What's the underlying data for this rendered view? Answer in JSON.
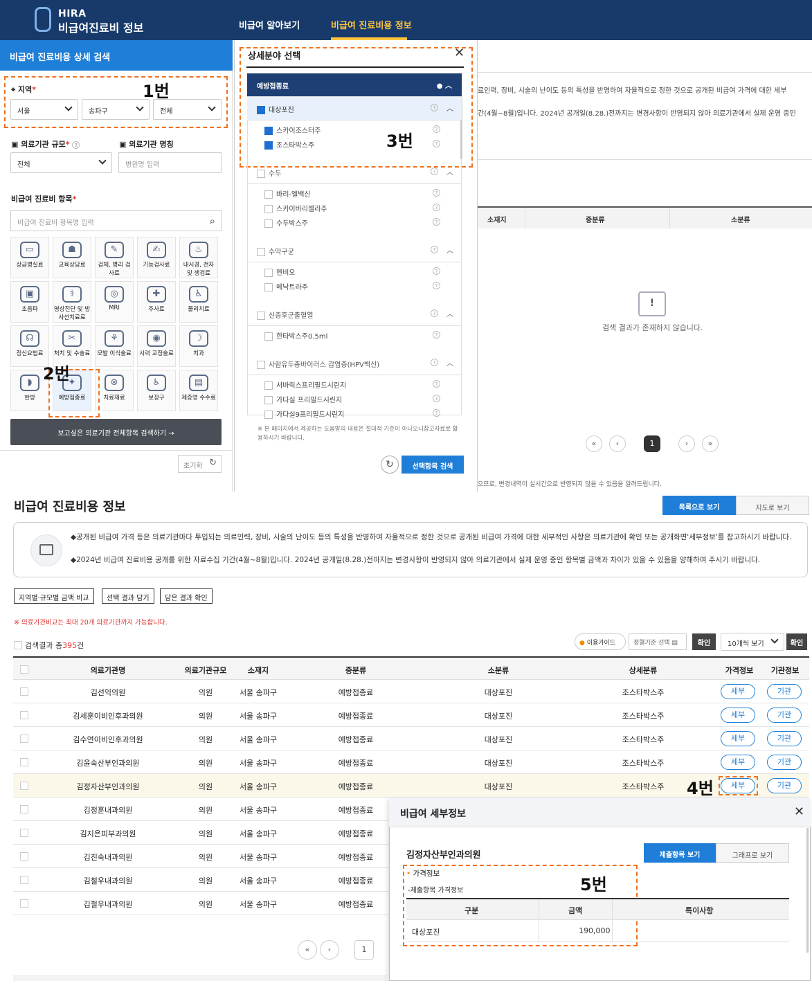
{
  "header": {
    "logo_top": "HIRA",
    "logo_bottom": "비급여진료비 정보",
    "nav": [
      "비급여 알아보기",
      "비급여 진료비용 정보"
    ]
  },
  "left_panel": {
    "title": "비급여 진료비용 상세 검색",
    "region_label": "지역",
    "region_selects": [
      "서울",
      "송파구",
      "전체"
    ],
    "scale_label": "의료기관 규모",
    "scale_value": "전체",
    "name_label": "의료기관 명칭",
    "name_placeholder": "병원명 입력",
    "items_label": "비급여 진료비 항목",
    "items_placeholder": "비급여 진료비 항목명 입력",
    "categories": [
      "상급병실료",
      "교육상담료",
      "검체, 병리 검사료",
      "기능검사료",
      "내시경, 천자 및 생검료",
      "초음파",
      "영상진단 및 방사선치료료",
      "MRI",
      "주사료",
      "물리치료",
      "정신요법료",
      "처치 및 수술료",
      "모발 이식술료",
      "시력 교정술료",
      "치과",
      "한방",
      "예방접종료",
      "치료재료",
      "보장구",
      "제증명 수수료"
    ],
    "search_all_button": "보고싶은 의료기관 전체항목 검색하기 →",
    "reset_button": "초기화"
  },
  "labels": {
    "n1": "1번",
    "n2": "2번",
    "n3": "3번",
    "n4": "4번",
    "n5": "5번"
  },
  "modal": {
    "title": "상세분야 선택",
    "group1": "예방접종료",
    "groups": [
      {
        "name": "대상포진",
        "items": [
          "스카이조스터주",
          "조스타박스주"
        ]
      },
      {
        "name": "수두",
        "items": [
          "바리-엘백신",
          "스카이바리셀라주",
          "수두박스주"
        ]
      },
      {
        "name": "수막구균",
        "items": [
          "멘비오",
          "메낙트라주"
        ]
      },
      {
        "name": "신증후군출혈열",
        "items": [
          "한타박스주0.5ml"
        ]
      },
      {
        "name": "사람유두종바이러스 감염증(HPV백신)",
        "items": [
          "서바릭스프리필드시린지",
          "가다실 프리필드시린지",
          "가다실9프리필드시린지"
        ]
      }
    ],
    "note": "※ 본 페이지에서 제공하는 도움말의 내용은 절대적 기준이 아니오니참고자료로 활용하시기 바랍니다.",
    "search_button": "선택항목 검색"
  },
  "right_panel": {
    "text1": "료인력, 장비, 시술의 난이도 등의 특성을 반영하여 자율적으로 정한 것으로 공개된 비급여 가격에 대한 세부",
    "text2": "간(4월~8월)입니다. 2024년 공개일(8.28.)전까지는 변경사항이 반영되지 않아 의료기관에서 실제 운영 중인",
    "cols": [
      "소재지",
      "중분류",
      "소분류"
    ],
    "empty": "검색 결과가 존재하지 않습니다.",
    "page": "1",
    "footnote": "으므로, 변경내역이 실시간으로 반영되지 않을 수 있음을 알려드립니다."
  },
  "main": {
    "title": "비급여 진료비용 정보",
    "view_list": "목록으로 보기",
    "view_map": "지도로 보기",
    "info1": "◆공개된 비급여 가격 등은 의료기관마다 투입되는 의료인력, 장비, 시술의 난이도 등의 특성을 반영하여 자율적으로 정한 것으로 공개된 비급여 가격에 대한 세부적인 사항은 의료기관에 확인 또는 공개화면'세부정보'를 참고하시기 바랍니다.",
    "info2": "◆2024년 비급여 진료비용 공개를 위한 자료수집 기간(4월~8월)입니다. 2024년 공개일(8.28.)전까지는 변경사항이 반영되지 않아 의료기관에서 실제 운영 중인 항목별 금액과 차이가 있을 수 있음을 양해하여 주시기 바랍니다.",
    "buttons": [
      "지역별·규모별 금액 비교",
      "선택 결과 담기",
      "담은 결과 확인"
    ],
    "warning": "※ 의료기관비교는 최대 20개 의료기관까지 가능합니다.",
    "result_prefix": "검색결과 총",
    "result_count": "395",
    "result_suffix": "건",
    "guide": "이용가이드",
    "sort": "정렬기준 선택",
    "confirm": "확인",
    "per_page": "10개씩 보기",
    "columns": [
      "의료기관명",
      "의료기관규모",
      "소재지",
      "중분류",
      "소분류",
      "상세분류",
      "가격정보",
      "기관정보"
    ],
    "rows": [
      {
        "name": "김선익의원",
        "scale": "의원",
        "loc": "서울 송파구",
        "mid": "예방접종료",
        "small": "대상포진",
        "detail": "조스타박스주"
      },
      {
        "name": "김세훈이비인후과의원",
        "scale": "의원",
        "loc": "서울 송파구",
        "mid": "예방접종료",
        "small": "대상포진",
        "detail": "조스타박스주"
      },
      {
        "name": "김수연이비인후과의원",
        "scale": "의원",
        "loc": "서울 송파구",
        "mid": "예방접종료",
        "small": "대상포진",
        "detail": "조스타박스주"
      },
      {
        "name": "김윤숙산부인과의원",
        "scale": "의원",
        "loc": "서울 송파구",
        "mid": "예방접종료",
        "small": "대상포진",
        "detail": "조스타박스주"
      },
      {
        "name": "김정자산부인과의원",
        "scale": "의원",
        "loc": "서울 송파구",
        "mid": "예방접종료",
        "small": "대상포진",
        "detail": "조스타박스주"
      },
      {
        "name": "김정훈내과의원",
        "scale": "의원",
        "loc": "서울 송파구",
        "mid": "예방접종료"
      },
      {
        "name": "김지은피부과의원",
        "scale": "의원",
        "loc": "서울 송파구",
        "mid": "예방접종료"
      },
      {
        "name": "김진숙내과의원",
        "scale": "의원",
        "loc": "서울 송파구",
        "mid": "예방접종료"
      },
      {
        "name": "김철우내과의원",
        "scale": "의원",
        "loc": "서울 송파구",
        "mid": "예방접종료"
      },
      {
        "name": "김철우내과의원",
        "scale": "의원",
        "loc": "서울 송파구",
        "mid": "예방접종료"
      }
    ],
    "detail_btn": "세부",
    "inst_btn": "기관"
  },
  "detail_panel": {
    "title": "비급여 세부정보",
    "clinic": "김정자산부인과의원",
    "tab1": "제출항목 보기",
    "tab2": "그래프로 보기",
    "price_title": "가격정보",
    "sub_title": "-제출항목 가격정보",
    "cols": [
      "구분",
      "금액",
      "특이사항"
    ],
    "row_name": "대상포진",
    "row_amount": "190,000"
  }
}
